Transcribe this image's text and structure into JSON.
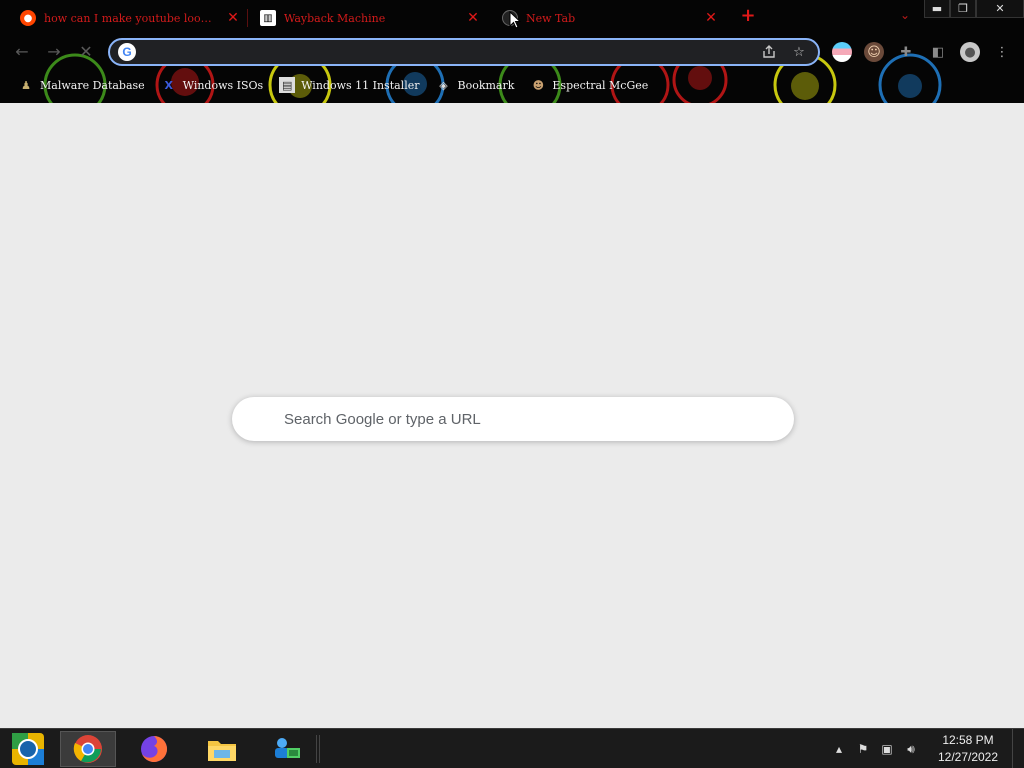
{
  "browser": {
    "tabs": [
      {
        "title": "how can I make youtube look like",
        "favicon": "reddit-icon",
        "active": false
      },
      {
        "title": "Wayback Machine",
        "favicon": "archive-icon",
        "active": false
      },
      {
        "title": "New Tab",
        "favicon": "tumblr-icon",
        "active": true
      }
    ],
    "new_tab_symbol": "+",
    "tab_close_symbol": "✕",
    "window_controls": {
      "minimize": "▬",
      "restore": "❐",
      "close": "✕"
    },
    "toolbar": {
      "back": "←",
      "forward": "→",
      "reload": "✕",
      "omnibox_value": "",
      "share_icon": "share-icon",
      "bookmark_star": "☆",
      "menu": "⋮"
    },
    "bookmarks": [
      {
        "label": "Malware Database",
        "icon": "malware-icon"
      },
      {
        "label": "Windows ISOs",
        "icon": "x-icon"
      },
      {
        "label": "Windows 11 Installer",
        "icon": "installer-icon"
      },
      {
        "label": "Bookmark",
        "icon": "site-icon"
      },
      {
        "label": "Espectral McGee",
        "icon": "person-icon"
      }
    ]
  },
  "ntp": {
    "search_placeholder": "Search Google or type a URL"
  },
  "taskbar": {
    "apps": [
      "start-orb",
      "chrome",
      "firefox",
      "file-explorer",
      "network-app"
    ],
    "active_app": "chrome",
    "clock_time": "12:58 PM",
    "clock_date": "12/27/2022"
  },
  "colors": {
    "tab_text": "#d21b1b",
    "omnibox_focus": "#8ab4f8",
    "ntp_bg": "#ebebeb"
  }
}
